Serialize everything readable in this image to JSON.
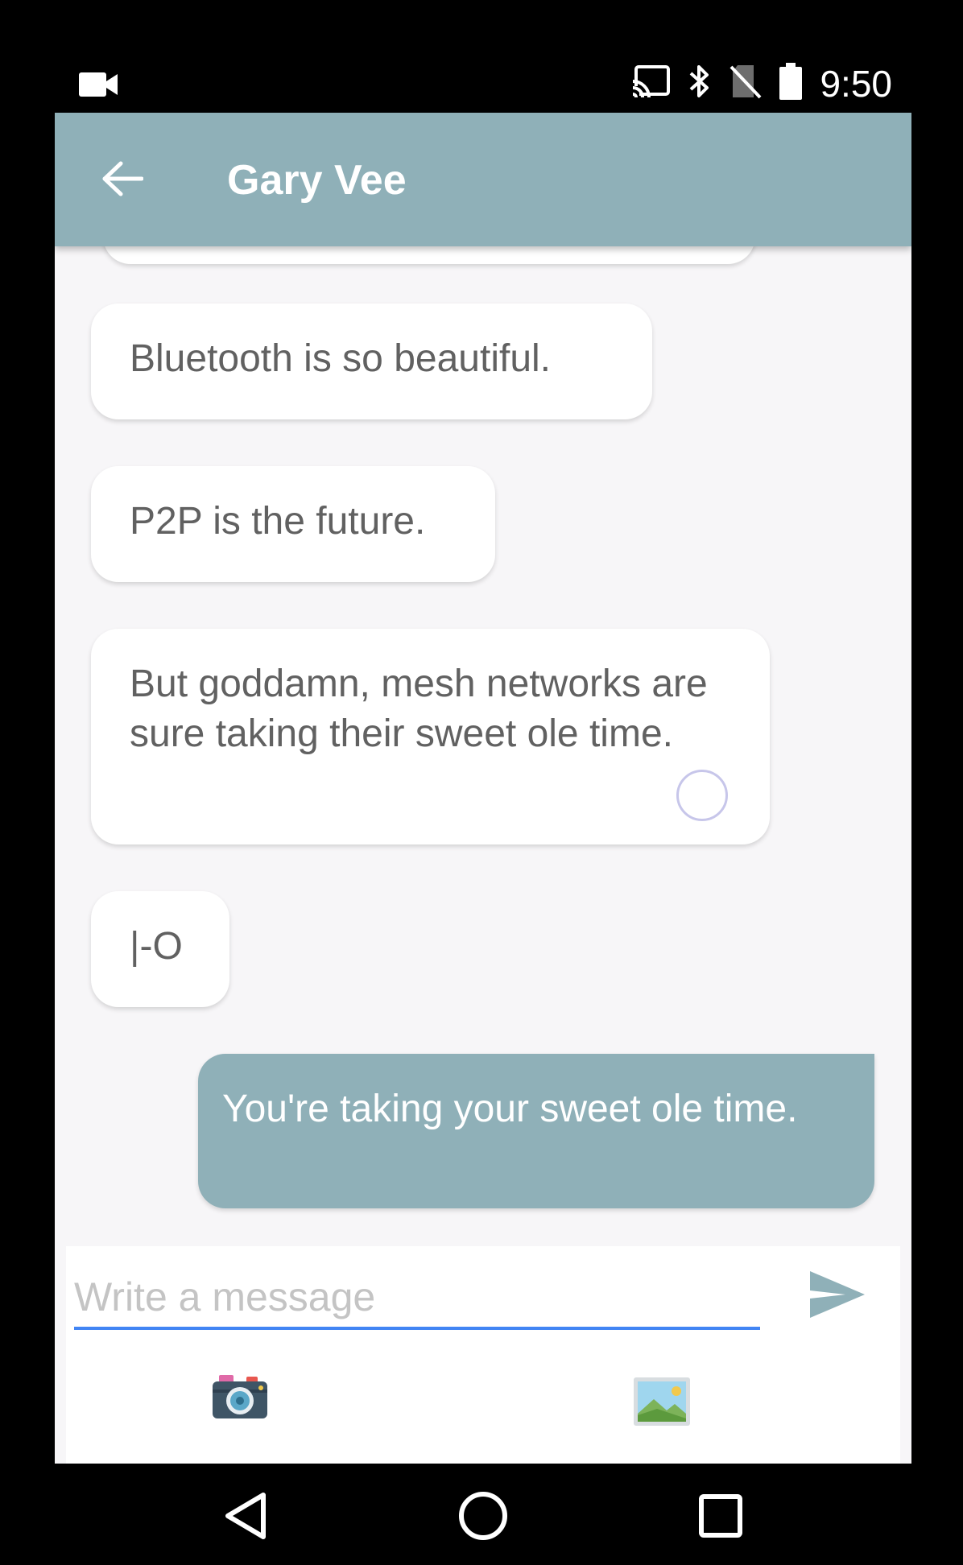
{
  "status_bar": {
    "time": "9:50",
    "icons": [
      "video-camera-icon",
      "cast-icon",
      "bluetooth-icon",
      "no-sim-icon",
      "battery-icon"
    ]
  },
  "toolbar": {
    "title": "Gary Vee",
    "back_icon": "arrow-left-icon"
  },
  "messages": [
    {
      "direction": "incoming",
      "text": "Bluetooth is so beautiful."
    },
    {
      "direction": "incoming",
      "text": "P2P is the future."
    },
    {
      "direction": "incoming",
      "text": "But goddamn, mesh networks are sure taking their sweet ole time."
    },
    {
      "direction": "incoming",
      "text": "|-O"
    },
    {
      "direction": "outgoing",
      "text": "You're taking your sweet ole time."
    }
  ],
  "composer": {
    "placeholder": "Write a message",
    "value": "",
    "send_icon": "send-icon",
    "camera_icon": "camera-icon",
    "gallery_icon": "image-gallery-icon"
  },
  "colors": {
    "toolbar": "#8fb0b8",
    "outgoing_bubble": "#8fb0b8",
    "incoming_bubble": "#ffffff",
    "input_underline": "#4285f4",
    "background": "#f7f6f8"
  },
  "nav_bar": {
    "icons": [
      "back-triangle-icon",
      "home-circle-icon",
      "recents-square-icon"
    ]
  }
}
